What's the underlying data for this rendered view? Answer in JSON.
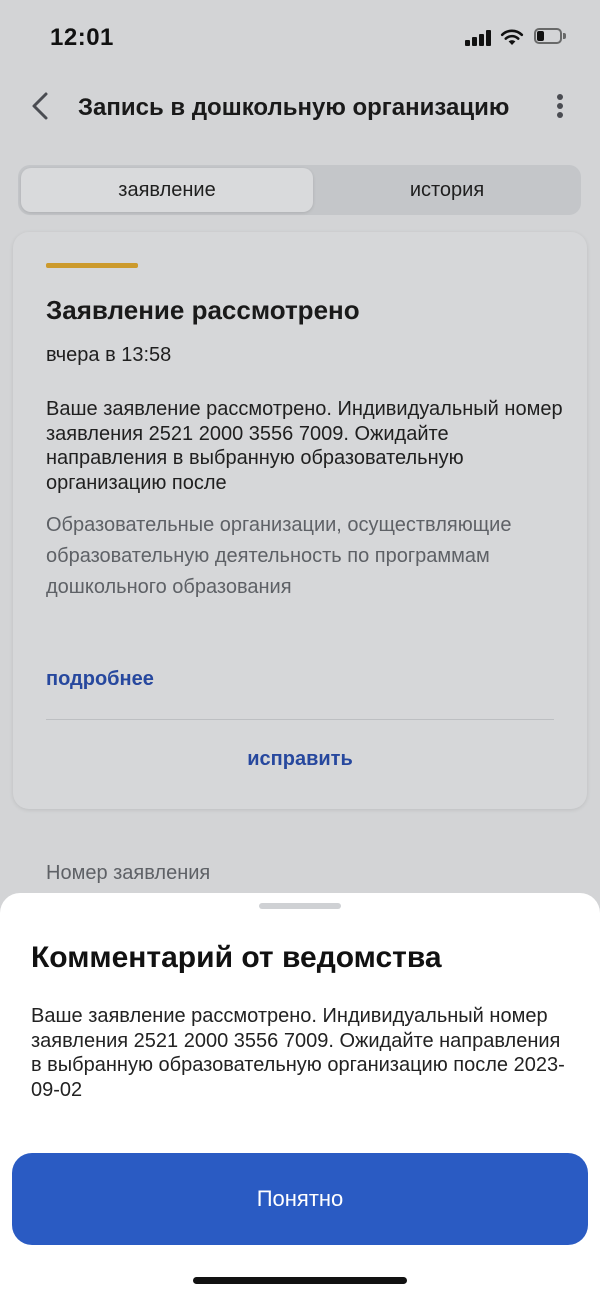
{
  "status_bar": {
    "time": "12:01"
  },
  "header": {
    "title": "Запись в дошкольную организацию"
  },
  "tabs": [
    {
      "label": "заявление",
      "active": true
    },
    {
      "label": "история",
      "active": false
    }
  ],
  "status_card": {
    "accent_color": "#cc9a2c",
    "title": "Заявление рассмотрено",
    "time": "вчера в 13:58",
    "message": "Ваше заявление рассмотрено. Индивидуальный номер заявления 2521 2000 3556 7009. Ожидайте направления в выбранную образовательную организацию после",
    "organization_type": "Образовательные организации, осуществляющие образовательную деятельность по программам дошкольного образования",
    "details_link": "подробнее",
    "fix_button": "исправить"
  },
  "application_number_label": "Номер заявления",
  "sheet": {
    "title": "Комментарий от ведомства",
    "text": "Ваше заявление рассмотрено. Индивидуальный номер заявления 2521 2000 3556 7009. Ожидайте направления в выбранную образовательную организацию после 2023-09-02",
    "button": "Понятно",
    "button_color": "#2a5bc3"
  }
}
